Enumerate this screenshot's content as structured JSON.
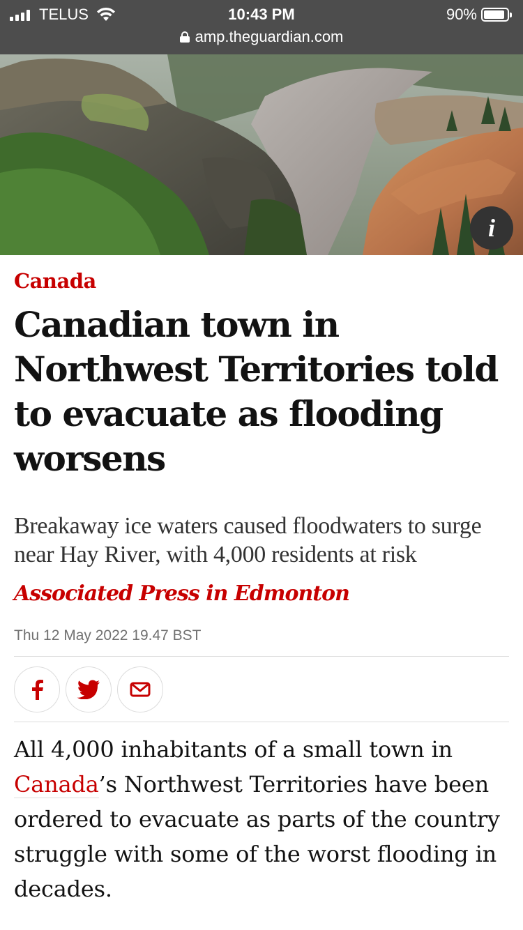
{
  "status_bar": {
    "carrier": "TELUS",
    "time": "10:43 PM",
    "battery_percent": "90%",
    "battery_level": 0.9,
    "url": "amp.theguardian.com"
  },
  "hero": {
    "info_label": "i"
  },
  "article": {
    "section": "Canada",
    "headline": "Canadian town in Northwest Territories told to evacuate as flooding worsens",
    "standfirst": "Breakaway ice waters caused floodwaters to surge near Hay River, with 4,000 residents at risk",
    "byline": "Associated Press in Edmonton",
    "dateline": "Thu 12 May 2022 19.47 BST",
    "share": [
      "facebook-icon",
      "twitter-icon",
      "email-icon"
    ],
    "body_before_link": "All 4,000 inhabitants of a small town in ",
    "body_link": "Canada",
    "body_after_link": "’s Northwest Territories have been ordered to evacuate as parts of the country struggle with some of the worst flooding in decades."
  },
  "colors": {
    "accent": "#c70000",
    "status_bar": "#4d4d4d",
    "text": "#121212"
  }
}
